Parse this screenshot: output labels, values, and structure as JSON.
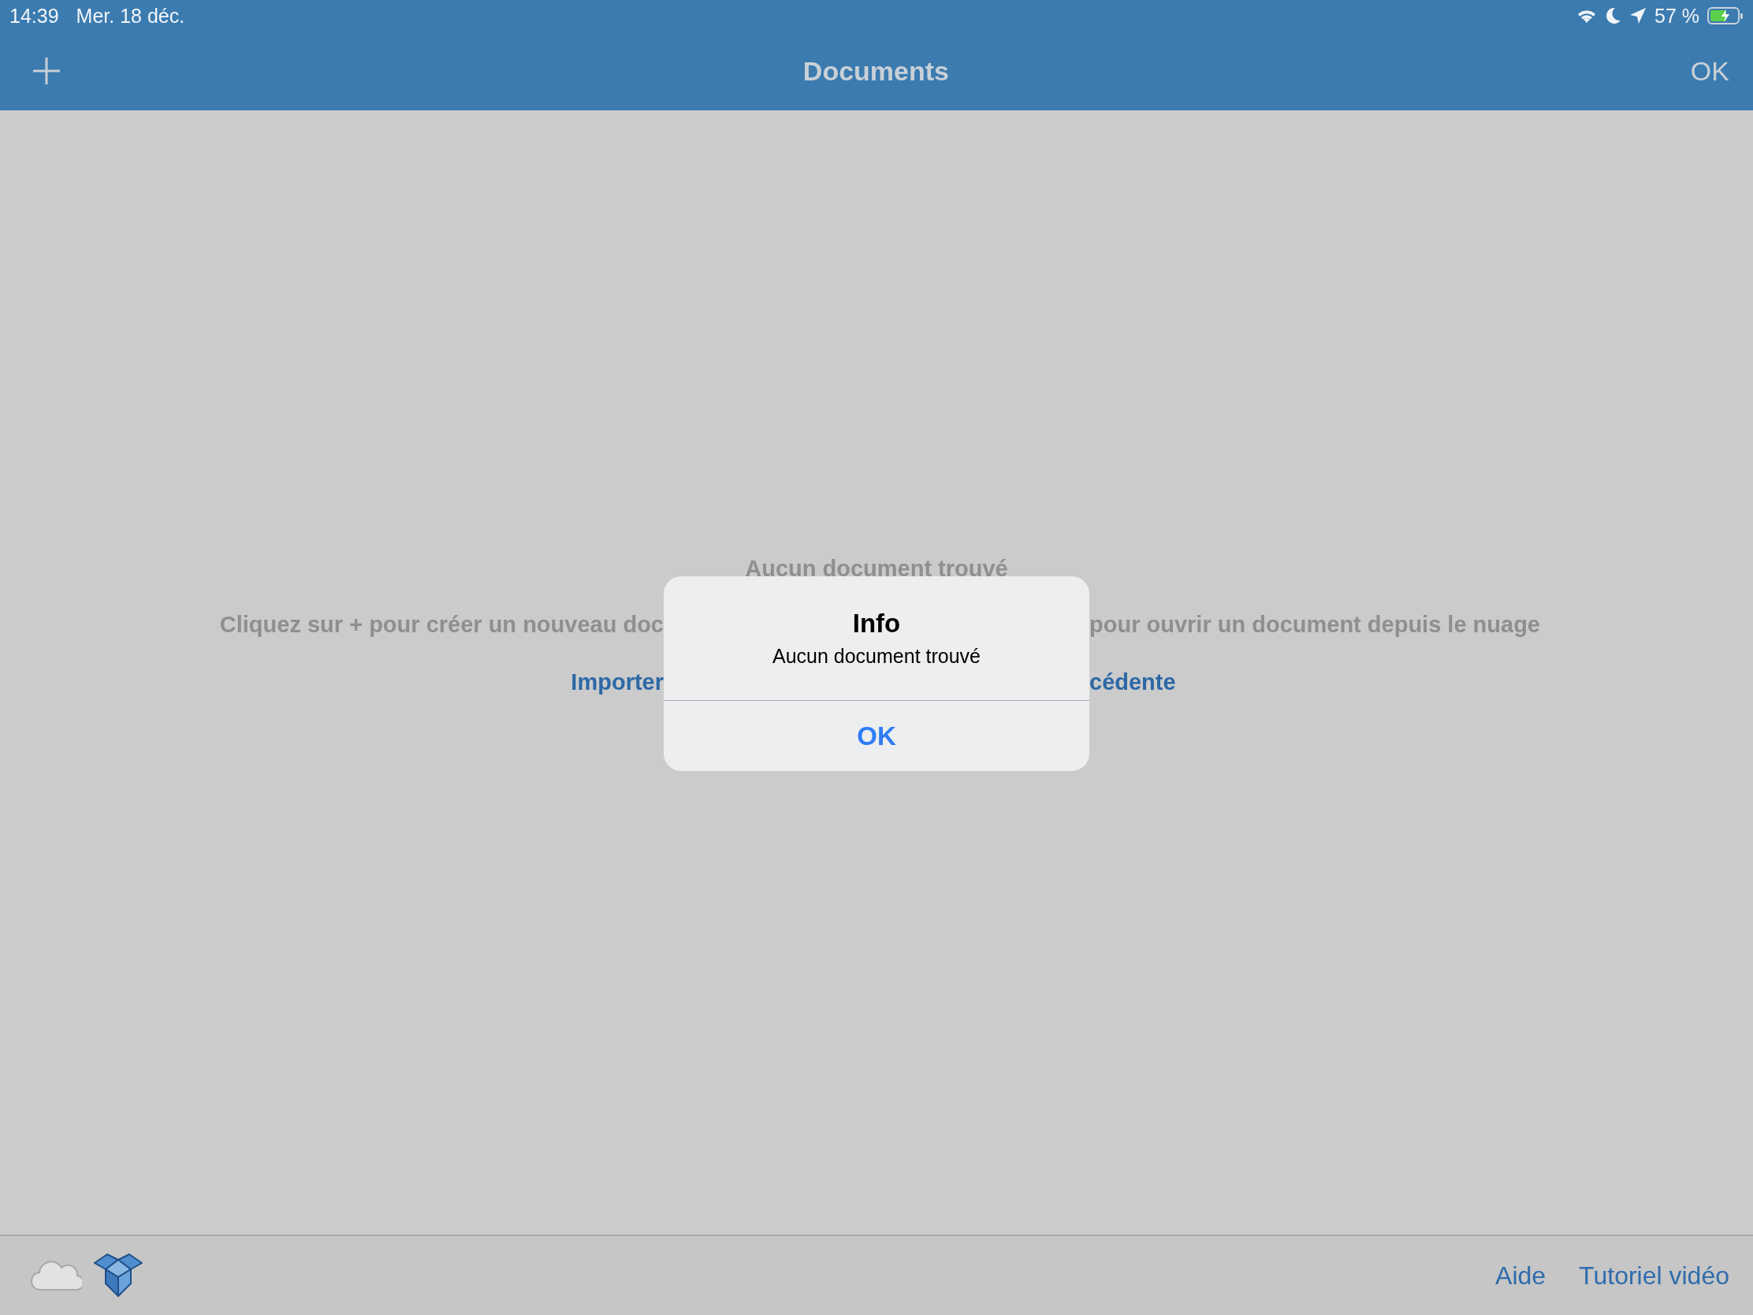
{
  "status_bar": {
    "time": "14:39",
    "date": "Mer. 18 déc.",
    "battery": "57 %"
  },
  "nav_bar": {
    "title": "Documents",
    "done": "OK"
  },
  "empty_state": {
    "title": "Aucun document trouvé",
    "hint_left": "Cliquez sur + pour créer un nouveau doc",
    "hint_right": "pour ouvrir un document depuis le nuage",
    "link_left": "Importer",
    "link_right": "cédente"
  },
  "dialog": {
    "title": "Info",
    "message": "Aucun document trouvé",
    "button": "OK"
  },
  "toolbar": {
    "links": [
      "Aide",
      "Tutoriel vidéo"
    ]
  }
}
